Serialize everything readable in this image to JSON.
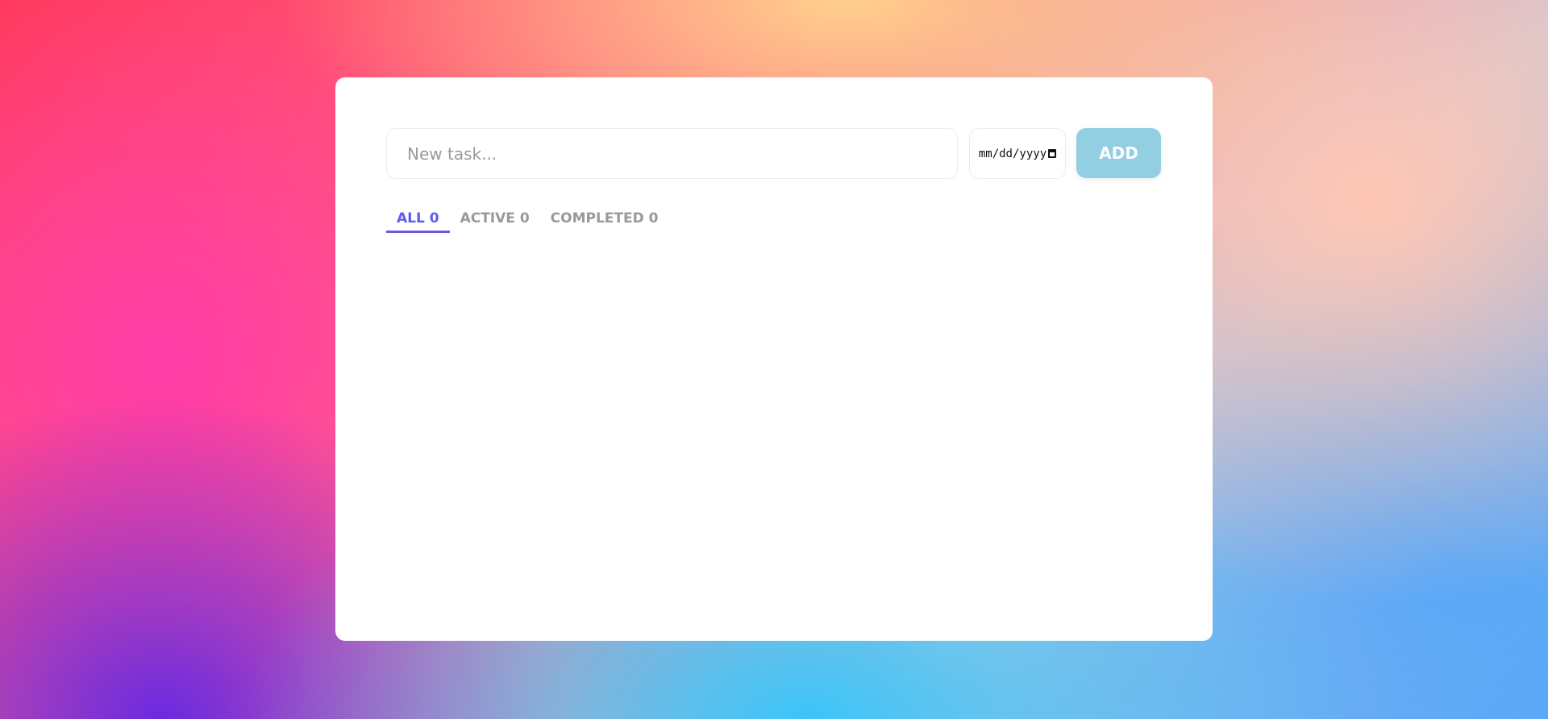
{
  "form": {
    "task_placeholder": "New task...",
    "date_placeholder": "mm/dd/yyyy",
    "add_label": "ADD"
  },
  "tabs": [
    {
      "label": "ALL 0",
      "active": true
    },
    {
      "label": "ACTIVE 0"
    },
    {
      "label": "COMPLETED 0"
    }
  ],
  "colors": {
    "accent": "#5b5bf0",
    "add_button": "#92cfe2"
  },
  "icons": {
    "date": "calendar-icon"
  }
}
